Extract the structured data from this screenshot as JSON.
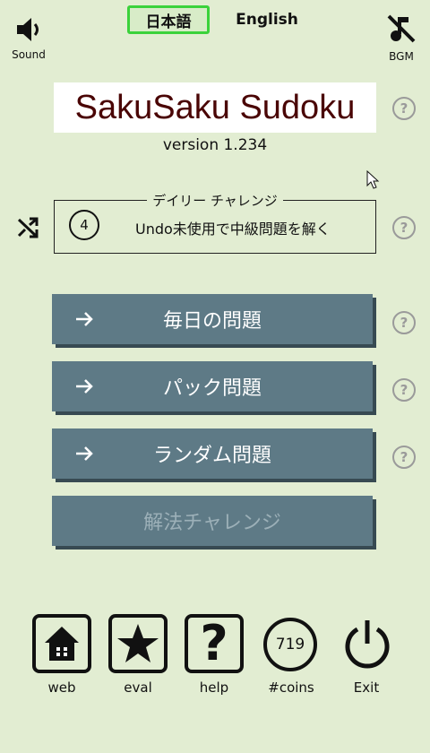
{
  "top": {
    "sound_label": "Sound",
    "bgm_label": "BGM",
    "lang_ja": "日本語",
    "lang_en": "English"
  },
  "title": "SakuSaku Sudoku",
  "version": "version 1.234",
  "daily": {
    "title": "デイリー チャレンジ",
    "number": "4",
    "task": "Undo未使用で中級問題を解く"
  },
  "menu": [
    {
      "label": "毎日の問題"
    },
    {
      "label": "パック問題"
    },
    {
      "label": "ランダム問題"
    },
    {
      "label": "解法チャレンジ"
    }
  ],
  "bottom": {
    "web": "web",
    "eval": "eval",
    "help": "help",
    "coins_label": "#coins",
    "coins_value": "719",
    "exit": "Exit"
  },
  "colors": {
    "background": "#e2edd2",
    "button": "#5e7a86",
    "title_text": "#4a0505",
    "lang_active_border": "#3bd23b"
  }
}
